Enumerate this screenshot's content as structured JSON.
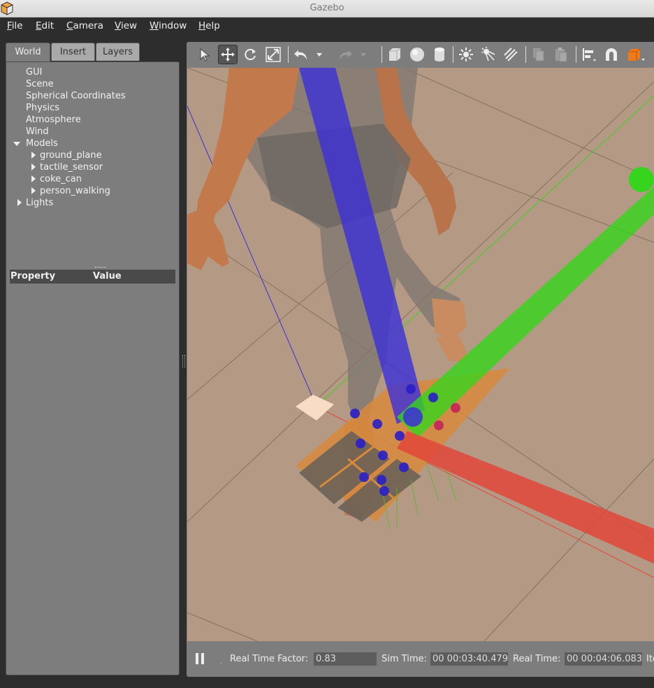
{
  "window": {
    "title": "Gazebo"
  },
  "menu": [
    {
      "mnemonic": "F",
      "rest": "ile"
    },
    {
      "mnemonic": "E",
      "rest": "dit"
    },
    {
      "mnemonic": "C",
      "rest": "amera"
    },
    {
      "mnemonic": "V",
      "rest": "iew"
    },
    {
      "mnemonic": "W",
      "rest": "indow"
    },
    {
      "mnemonic": "H",
      "rest": "elp"
    }
  ],
  "left_panel": {
    "tabs": [
      "World",
      "Insert",
      "Layers"
    ],
    "active_tab": "World",
    "tree": {
      "gui": "GUI",
      "scene": "Scene",
      "spherical": "Spherical Coordinates",
      "physics": "Physics",
      "atmosphere": "Atmosphere",
      "wind": "Wind",
      "models": "Models",
      "model_items": [
        "ground_plane",
        "tactile_sensor",
        "coke_can",
        "person_walking"
      ],
      "lights": "Lights"
    },
    "properties": {
      "col_property": "Property",
      "col_value": "Value"
    }
  },
  "toolbar": {
    "icons": [
      "select-icon",
      "translate-icon",
      "rotate-icon",
      "scale-icon",
      "undo-icon",
      "undo-history-icon",
      "redo-icon",
      "redo-history-icon",
      "box-icon",
      "sphere-icon",
      "cylinder-icon",
      "point-light-icon",
      "spot-light-icon",
      "directional-light-icon",
      "copy-icon",
      "paste-icon",
      "align-icon",
      "snap-icon",
      "view-angle-icon"
    ],
    "active_tool": "translate"
  },
  "statusbar": {
    "rtf_label": "Real Time Factor:",
    "rtf_value": "0.83",
    "sim_label": "Sim Time:",
    "sim_value": "00 00:03:40.479",
    "real_label": "Real Time:",
    "real_value": "00 00:04:06.083",
    "iter_label": "Iterations:"
  },
  "colors": {
    "x_axis": "#e0463a",
    "y_axis": "#36d41c",
    "z_axis": "#3b2fd8",
    "ground": "#b79c86",
    "sensor_board": "#d88a3c",
    "panel_bg": "#7d7d7d"
  }
}
